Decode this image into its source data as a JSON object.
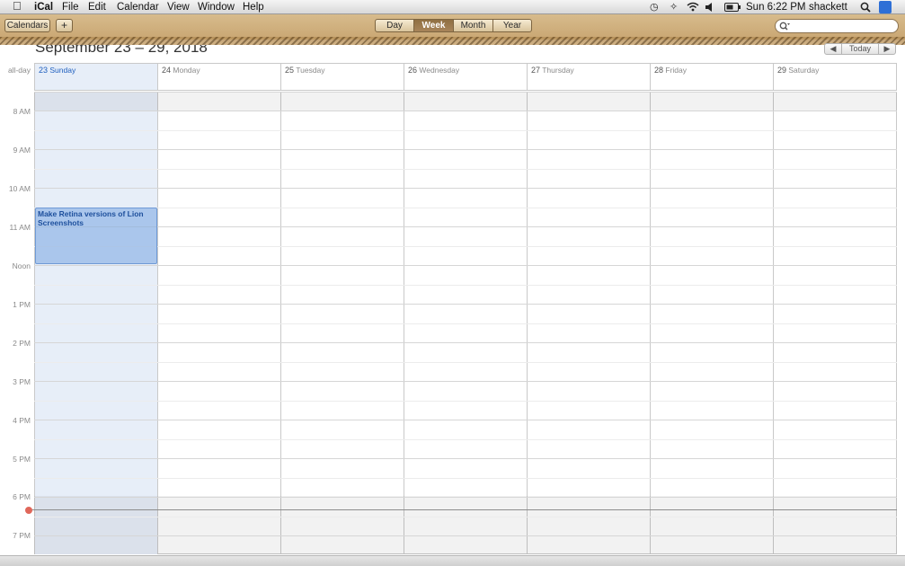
{
  "menubar": {
    "app_name": "iCal",
    "menus": [
      "File",
      "Edit",
      "Calendar",
      "View",
      "Window",
      "Help"
    ],
    "clock": "Sun 6:22 PM",
    "user": "shackett",
    "status_icons": [
      "time-machine-icon",
      "bluetooth-icon",
      "wifi-icon",
      "volume-icon",
      "battery-icon",
      "spotlight-icon",
      "notification-icon"
    ]
  },
  "toolbar": {
    "calendars_label": "Calendars",
    "add_label": "+",
    "views": [
      "Day",
      "Week",
      "Month",
      "Year"
    ],
    "active_view": "Week",
    "search_placeholder": ""
  },
  "header": {
    "range_title": "September 23 – 29, 2018",
    "prev_label": "◀",
    "today_label": "Today",
    "next_label": "▶",
    "allday_label": "all-day"
  },
  "days": [
    {
      "num": "23",
      "name": "Sunday",
      "today": true
    },
    {
      "num": "24",
      "name": "Monday"
    },
    {
      "num": "25",
      "name": "Tuesday"
    },
    {
      "num": "26",
      "name": "Wednesday"
    },
    {
      "num": "27",
      "name": "Thursday"
    },
    {
      "num": "28",
      "name": "Friday"
    },
    {
      "num": "29",
      "name": "Saturday"
    }
  ],
  "hours": [
    "8 AM",
    "9 AM",
    "10 AM",
    "11 AM",
    "Noon",
    "1 PM",
    "2 PM",
    "3 PM",
    "4 PM",
    "5 PM",
    "6 PM",
    "7 PM"
  ],
  "event": {
    "title": "Make Retina versions of Lion Screenshots",
    "day": "23 Sunday",
    "color": "#6f9ad6"
  },
  "colors": {
    "leather": "#c9a672",
    "today_tint": "#e7eef8",
    "now_indicator": "#e0675a"
  }
}
